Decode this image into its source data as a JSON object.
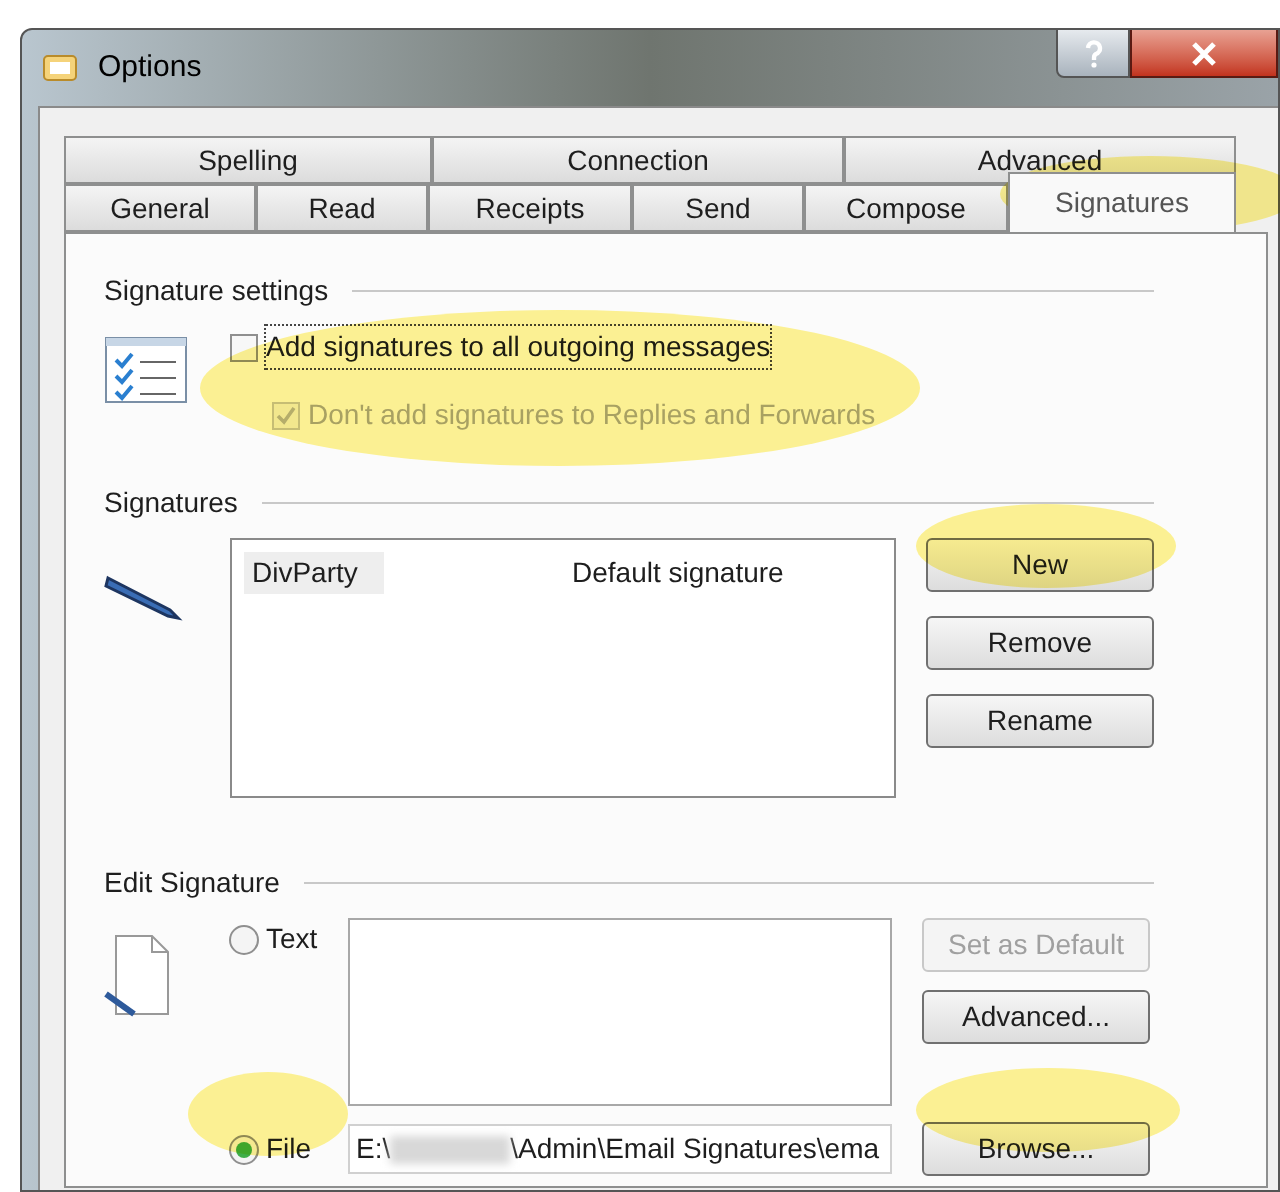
{
  "window": {
    "title": "Options"
  },
  "tab_rows": [
    [
      {
        "label": "Spelling",
        "selected": false
      },
      {
        "label": "Connection",
        "selected": false
      },
      {
        "label": "Advanced",
        "selected": false
      }
    ],
    [
      {
        "label": "General",
        "selected": false
      },
      {
        "label": "Read",
        "selected": false
      },
      {
        "label": "Receipts",
        "selected": false
      },
      {
        "label": "Send",
        "selected": false
      },
      {
        "label": "Compose",
        "selected": false
      },
      {
        "label": "Signatures",
        "selected": true
      }
    ]
  ],
  "signature_settings": {
    "heading": "Signature settings",
    "options": [
      {
        "label": "Add signatures to all outgoing messages",
        "checked": false,
        "disabled": false
      },
      {
        "label": "Don't add signatures to Replies and Forwards",
        "checked": true,
        "disabled": true
      }
    ]
  },
  "signatures": {
    "heading": "Signatures",
    "rows": [
      {
        "name": "DivParty",
        "note": "Default signature",
        "selected": true
      }
    ],
    "buttons": [
      {
        "label": "New",
        "disabled": false
      },
      {
        "label": "Remove",
        "disabled": false
      },
      {
        "label": "Rename",
        "disabled": false
      }
    ]
  },
  "edit_signature": {
    "heading": "Edit Signature",
    "sources": [
      {
        "label": "Text",
        "selected": false
      },
      {
        "label": "File",
        "selected": true
      }
    ],
    "path_start": "E:\\",
    "path_end": "\\Admin\\Email Signatures\\ema",
    "buttons": [
      {
        "label": "Set as Default",
        "disabled": true
      },
      {
        "label": "Advanced...",
        "disabled": false
      },
      {
        "label": "Browse...",
        "disabled": false
      }
    ]
  }
}
